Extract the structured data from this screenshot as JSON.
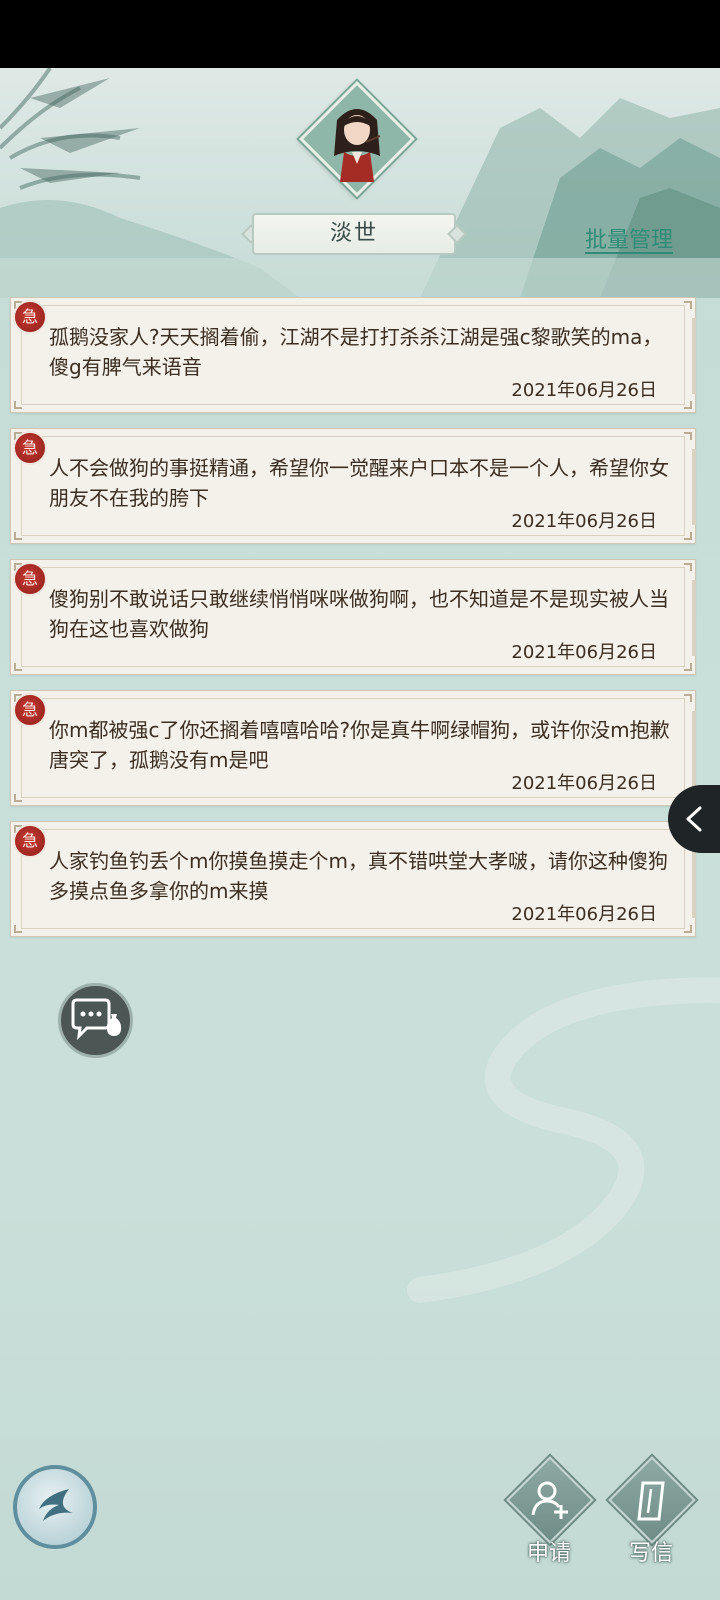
{
  "header": {
    "friend_name": "淡世",
    "batch_manage_label": "批量管理"
  },
  "messages": [
    {
      "badge": "急",
      "text": "孤鹅没家人?天天搁着偷，江湖不是打打杀杀江湖是强c黎歌笑的ma，傻g有脾气来语音",
      "date": "2021年06月26日"
    },
    {
      "badge": "急",
      "text": "人不会做狗的事挺精通，希望你一觉醒来户口本不是一个人，希望你女朋友不在我的胯下",
      "date": "2021年06月26日"
    },
    {
      "badge": "急",
      "text": "傻狗别不敢说话只敢继续悄悄咪咪做狗啊，也不知道是不是现实被人当狗在这也喜欢做狗",
      "date": "2021年06月26日"
    },
    {
      "badge": "急",
      "text": "你m都被强c了你还搁着嘻嘻哈哈?你是真牛啊绿帽狗，或许你没m抱歉唐突了，孤鹅没有m是吧",
      "date": "2021年06月26日"
    },
    {
      "badge": "急",
      "text": "人家钓鱼钓丢个m你摸鱼摸走个m，真不错哄堂大孝啵，请你这种傻狗多摸点鱼多拿你的m来摸",
      "date": "2021年06月26日"
    }
  ],
  "actions": {
    "apply_label": "申请",
    "write_label": "写信"
  },
  "icons": {
    "side_tab": "chevron-left-icon",
    "chat": "chat-bubble-icon",
    "back": "back-arrow-icon",
    "apply": "add-person-icon",
    "write": "letter-icon"
  },
  "colors": {
    "accent_green": "#2f8d77",
    "seal_red": "#b42c25",
    "card_bg": "#f3f1ea",
    "text_dark": "#3b2e22"
  }
}
